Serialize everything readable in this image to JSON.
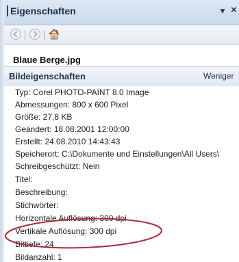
{
  "header": {
    "title": "Eigenschaften",
    "dropdown_icon": "chevron-down-icon",
    "close_icon": "close-icon"
  },
  "toolbar": {
    "buttons": [
      "back-icon",
      "forward-icon",
      "home-icon"
    ]
  },
  "file": {
    "name": "Blaue Berge.jpg"
  },
  "section": {
    "title": "Bildeigenschaften",
    "toggle_label": "Weniger"
  },
  "properties": [
    "Typ: Corel PHOTO-PAINT 8.0 Image",
    "Abmessungen: 800 x 600 Pixel",
    "Größe: 27,8 KB",
    "Geändert: 18.08.2001 12:00:00",
    "Erstellt: 24.08.2010 14:43:43",
    "Speicherort:  C:\\Dokumente und Einstellungen\\All Users\\",
    "Schreibgeschützt: Nein",
    "Titel:",
    "Beschreibung:",
    "Stichwörter:",
    "Horizontale Auflösung: 300 dpi",
    "Vertikale Auflösung: 300 dpi",
    "Bittiefe: 24",
    "Bildanzahl: 1"
  ],
  "colors": {
    "header_bg": "#c9d8ec",
    "highlight_ellipse": "#b0283a"
  }
}
